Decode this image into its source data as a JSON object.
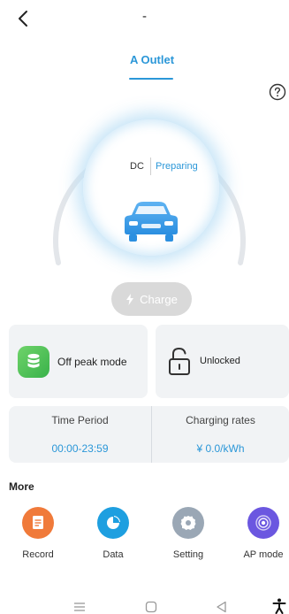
{
  "header": {
    "title": "-"
  },
  "tabs": [
    {
      "label": "A Outlet",
      "active": true
    }
  ],
  "status": {
    "connector_type": "DC",
    "state": "Preparing"
  },
  "charge_button": {
    "label": "Charge",
    "enabled": false
  },
  "mode_card": {
    "label": "Off peak mode"
  },
  "lock_card": {
    "label": "Unlocked"
  },
  "stats": {
    "time_period_label": "Time Period",
    "time_period_value": "00:00-23:59",
    "charging_rates_label": "Charging rates",
    "charging_rates_value": "¥ 0.0/kWh"
  },
  "more": {
    "title": "More",
    "items": [
      {
        "label": "Record",
        "icon": "document-icon",
        "color": "#f07a3a"
      },
      {
        "label": "Data",
        "icon": "pie-chart-icon",
        "color": "#1e9fe0"
      },
      {
        "label": "Setting",
        "icon": "gear-icon",
        "color": "#9aa7b5"
      },
      {
        "label": "AP mode",
        "icon": "broadcast-icon",
        "color": "#6b57e0"
      }
    ]
  },
  "colors": {
    "accent": "#2b97d8",
    "card_bg": "#f1f3f5",
    "mode_icon": "#4dbf4f"
  }
}
